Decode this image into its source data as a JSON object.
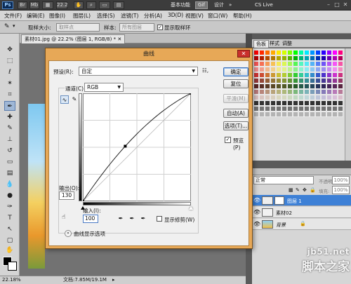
{
  "app_bar": {
    "logo": "Ps",
    "zoom": "22.2",
    "workspace_basic": "基本功能",
    "workspace_active": "Gif",
    "workspace_design": "设计",
    "workspace_more": "»",
    "cs_live": "CS Live"
  },
  "menu": {
    "items": [
      "文件(F)",
      "编辑(E)",
      "图像(I)",
      "图层(L)",
      "选择(S)",
      "滤镜(T)",
      "分析(A)",
      "3D(D)",
      "视图(V)",
      "窗口(W)",
      "帮助(H)"
    ]
  },
  "options_bar": {
    "sample_size_label": "取样大小:",
    "sample_size_value": "取样点",
    "sample_label": "样本:",
    "sample_value": "所有图层",
    "show_ring_label": "显示取样环"
  },
  "document": {
    "tab_title": "素材01.jpg @ 22.2% (图层 1, RGB/8) *",
    "zoom": "22.18%",
    "doc_size": "文档:7.85M/19.1M"
  },
  "curves": {
    "title": "曲线",
    "preset_label": "预设(R):",
    "preset_value": "自定",
    "preset_menu_icon": "☷,",
    "channel_label": "通道(C):",
    "channel_value": "RGB",
    "output_label": "输出(O):",
    "output_value": "130",
    "input_label": "输入(I):",
    "input_value": "100",
    "show_clipping_label": "显示修剪(W)",
    "curve_display_options": "曲线显示选项",
    "point": {
      "input": 100,
      "output": 130
    },
    "buttons": {
      "ok": "确定",
      "reset": "复位",
      "smooth": "平滑(M)",
      "auto": "自动(A)",
      "options": "选项(T)...",
      "preview": "预览(P)"
    }
  },
  "panels": {
    "swatch_tabs": [
      "色板",
      "样式",
      "调整"
    ],
    "blend_mode": "正常",
    "opacity_label": "不透明度:",
    "opacity_value": "100%",
    "fill_label": "填充:",
    "fill_value": "100%",
    "layers": [
      {
        "name": "图层 1",
        "selected": true
      },
      {
        "name": "素材02",
        "selected": false
      },
      {
        "name": "背景",
        "selected": false
      }
    ]
  },
  "watermark": {
    "url": "jb51.net",
    "text": "脚本之家"
  },
  "colors": {
    "dialog_frame": "#e7a857",
    "selected_layer": "#3d80d6",
    "close_button": "#c9302c"
  }
}
